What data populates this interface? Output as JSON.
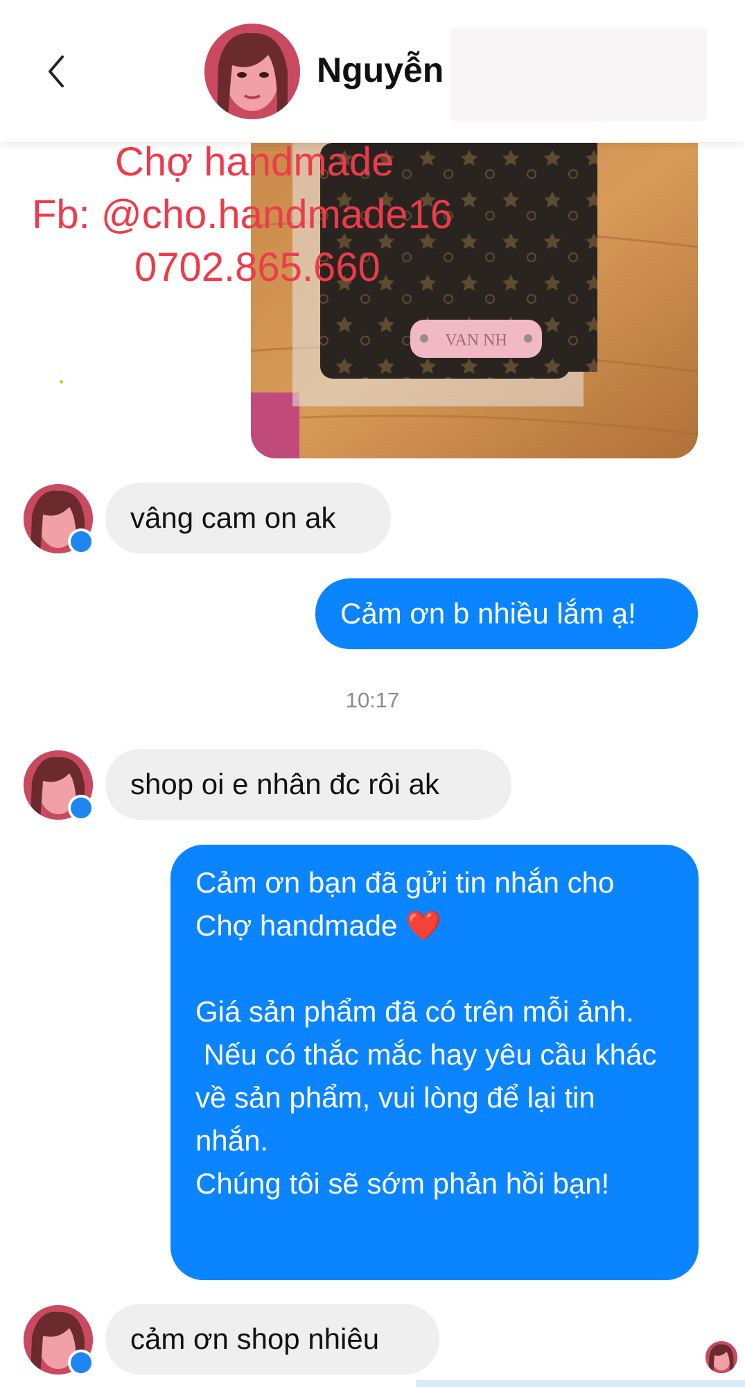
{
  "header": {
    "back_icon": "chevron-left-icon",
    "contact_name": "Nguyễn"
  },
  "watermark": {
    "line1": "Chợ handmade",
    "line2": "Fb: @cho.handmade16",
    "line3": "0702.865.660",
    "tag_text": "VAN NH",
    "color": "#ec3b4a"
  },
  "messages": {
    "m1": "vâng cam on ak",
    "m2": "Cảm ơn b nhiều lắm ạ!",
    "timestamp": "10:17",
    "m3": "shop oi e nhân đc rôi ak",
    "m4_p1": "Cảm ơn bạn đã gửi tin nhắn cho Chợ handmade ❤️",
    "m4_p2": "Giá sản phẩm đã có trên mỗi ảnh.",
    "m4_p3": " Nếu có thắc mắc hay yêu cầu khác về sản phẩm, vui lòng để lại tin nhắn.",
    "m4_p4": "Chúng tôi sẽ sớm phản hồi bạn!",
    "m5": "cảm ơn shop nhiêu"
  },
  "colors": {
    "outgoing_bubble": "#0a84ff",
    "incoming_bubble": "#efefef",
    "messenger_badge": "#1e86f0"
  }
}
